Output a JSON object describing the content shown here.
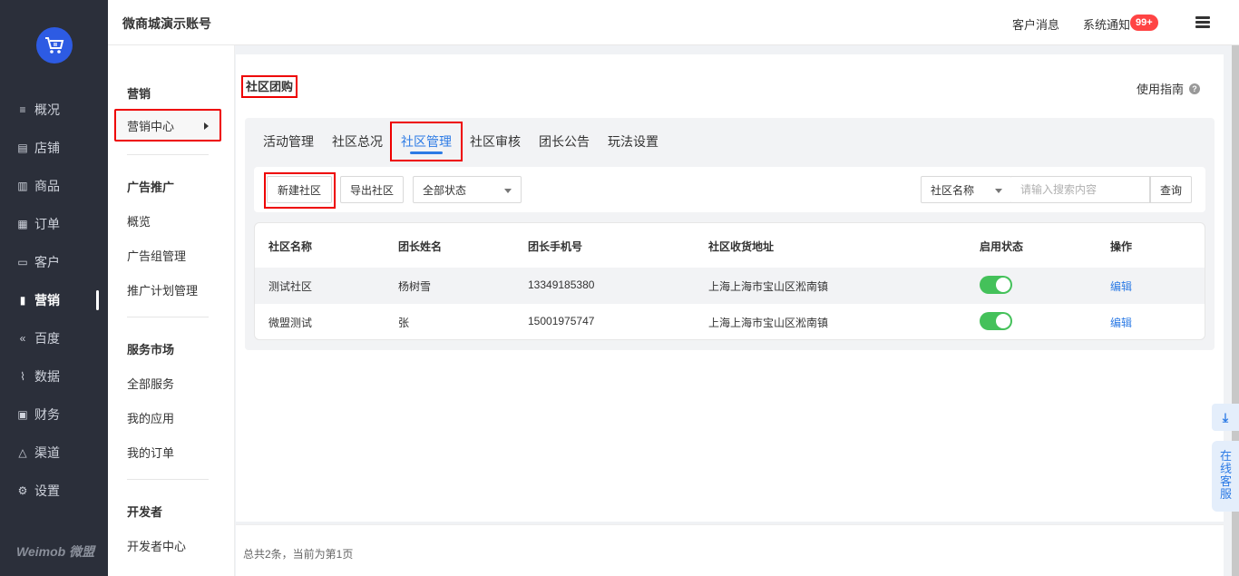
{
  "sidebar": {
    "items": [
      {
        "label": "概况",
        "icon": "list-icon"
      },
      {
        "label": "店铺",
        "icon": "store-icon"
      },
      {
        "label": "商品",
        "icon": "goods-icon"
      },
      {
        "label": "订单",
        "icon": "order-icon"
      },
      {
        "label": "客户",
        "icon": "customer-icon"
      },
      {
        "label": "营销",
        "icon": "bar-chart-icon"
      },
      {
        "label": "百度",
        "icon": "baidu-icon"
      },
      {
        "label": "数据",
        "icon": "data-icon"
      },
      {
        "label": "财务",
        "icon": "finance-icon"
      },
      {
        "label": "渠道",
        "icon": "channel-icon"
      },
      {
        "label": "设置",
        "icon": "settings-icon"
      }
    ],
    "brand": "Weimob 微盟"
  },
  "topbar": {
    "shop_name": "微商城演示账号",
    "customer_msg": "客户消息",
    "system_notice": "系统通知",
    "notice_badge": "99+"
  },
  "subnav": {
    "group1_title": "营销",
    "group1_active": "营销中心",
    "group2_title": "广告推广",
    "group2_items": [
      "概览",
      "广告组管理",
      "推广计划管理"
    ],
    "group3_title": "服务市场",
    "group3_items": [
      "全部服务",
      "我的应用",
      "我的订单"
    ],
    "group4_title": "开发者",
    "group4_items": [
      "开发者中心"
    ]
  },
  "main": {
    "title": "社区团购",
    "guide": "使用指南",
    "tabs": [
      "活动管理",
      "社区总况",
      "社区管理",
      "社区审核",
      "团长公告",
      "玩法设置"
    ],
    "toolbar": {
      "new_btn": "新建社区",
      "export_btn": "导出社区",
      "status_select": "全部状态",
      "search_field_select": "社区名称",
      "search_placeholder": "请输入搜索内容",
      "query_btn": "查询"
    },
    "table": {
      "headers": [
        "社区名称",
        "团长姓名",
        "团长手机号",
        "社区收货地址",
        "启用状态",
        "操作"
      ],
      "rows": [
        {
          "name": "测试社区",
          "leader": "杨树雪",
          "phone": "13349185380",
          "address": "上海上海市宝山区淞南镇",
          "enabled": true,
          "action": "编辑"
        },
        {
          "name": "微盟测试",
          "leader": "张",
          "phone": "15001975747",
          "address": "上海上海市宝山区淞南镇",
          "enabled": true,
          "action": "编辑"
        }
      ]
    },
    "footer": "总共2条，当前为第1页"
  },
  "floating": {
    "customer_service": "在线客服"
  },
  "colors": {
    "accent": "#2d7be5",
    "highlight": "#e00000",
    "toggle_on": "#44c15a",
    "sidebar_bg": "#2b2f3a"
  }
}
